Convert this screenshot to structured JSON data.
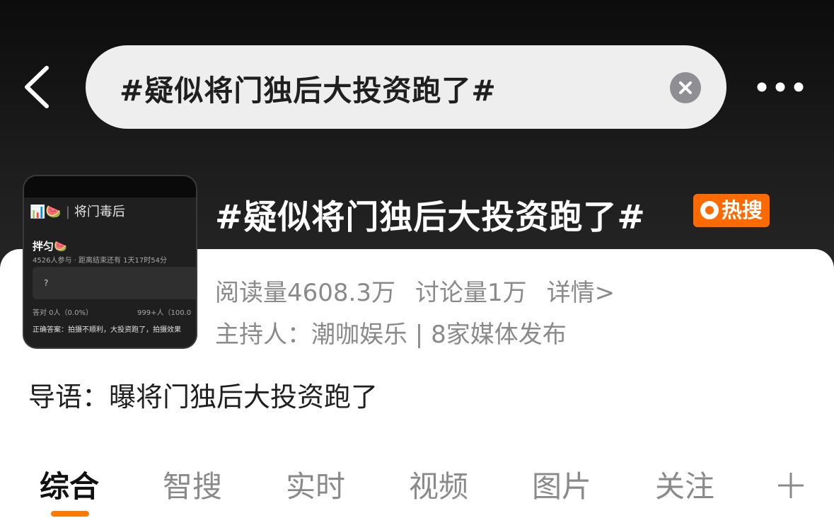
{
  "header": {
    "search_query": "#疑似将门独后大投资跑了#",
    "icons": [
      "back-icon",
      "clear-icon",
      "more-icon"
    ]
  },
  "thumbnail": {
    "header_emoji": "📊🍉",
    "header_title": "将门毒后",
    "poll_title": "拌匀🍉",
    "poll_meta": "4526人参与 · 距离结束还有 1天17时54分",
    "answer_placeholder": "?",
    "stat_left": "答对 0人（0.0%）",
    "stat_right": "999+人（100.0",
    "correct_answer": "正确答案：拍摄不顺利，大投资跑了，拍摄效果"
  },
  "topic": {
    "title": "#疑似将门独后大投资跑了#",
    "badge": "热搜",
    "read_count": "阅读量4608.3万",
    "discuss_count": "讨论量1万",
    "details_link": "详情>",
    "host_line": "主持人：潮咖娱乐 | 8家媒体发布",
    "intro": "导语：曝将门独后大投资跑了"
  },
  "tabs": [
    {
      "label": "综合",
      "active": true
    },
    {
      "label": "智搜",
      "active": false
    },
    {
      "label": "实时",
      "active": false
    },
    {
      "label": "视频",
      "active": false
    },
    {
      "label": "图片",
      "active": false
    },
    {
      "label": "关注",
      "active": false
    }
  ],
  "colors": {
    "accent": "#ff7a00",
    "badge": "#ff6a00",
    "hero_bg": "#1c1c1c",
    "muted_text": "#8a8a8a"
  }
}
